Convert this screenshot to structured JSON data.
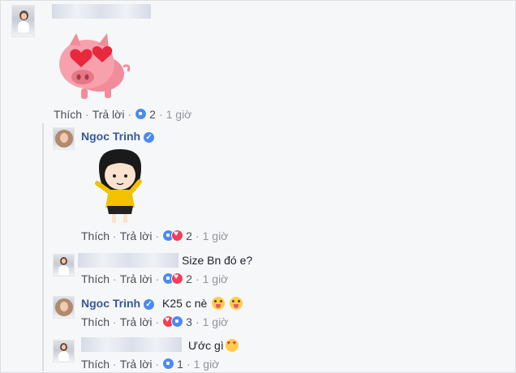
{
  "comments": [
    {
      "author": "",
      "text": "",
      "sticker": "pig-heart-eyes-sticker",
      "actions": {
        "like": "Thích",
        "reply": "Trả lời",
        "reactions": [
          "like"
        ],
        "count": "2",
        "time": "1 giờ"
      }
    },
    {
      "author": "Ngoc Trinh",
      "verified": true,
      "text": "",
      "sticker": "girl-cartoon-sticker",
      "actions": {
        "like": "Thích",
        "reply": "Trả lời",
        "reactions": [
          "like",
          "love"
        ],
        "count": "2",
        "time": "1 giờ"
      }
    },
    {
      "author": "",
      "text": "Size Bn đó e?",
      "actions": {
        "like": "Thích",
        "reply": "Trả lời",
        "reactions": [
          "like",
          "love"
        ],
        "count": "2",
        "time": "1 giờ"
      }
    },
    {
      "author": "Ngoc Trinh",
      "verified": true,
      "text": "K25 c nè",
      "emojis": [
        "tongue-emoji",
        "tongue-emoji"
      ],
      "actions": {
        "like": "Thích",
        "reply": "Trả lời",
        "reactions": [
          "love",
          "like"
        ],
        "count": "3",
        "time": "1 giờ"
      }
    },
    {
      "author": "",
      "text": "Ước gì",
      "emojis": [
        "heart-eyes-emoji"
      ],
      "actions": {
        "like": "Thích",
        "reply": "Trả lời",
        "reactions": [
          "like"
        ],
        "count": "1",
        "time": "1 giờ"
      }
    }
  ],
  "colors": {
    "link": "#365899",
    "text": "#1d2129",
    "meta": "#90949c",
    "like": "#4a8af4",
    "love": "#f33e58"
  }
}
